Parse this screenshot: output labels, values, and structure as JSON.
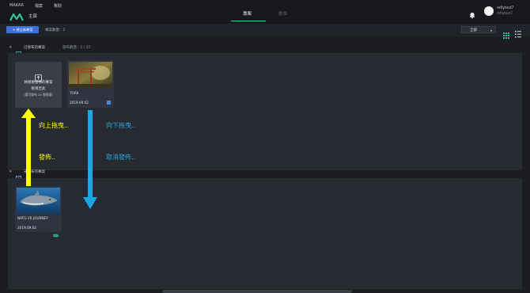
{
  "top_menu": {
    "brand": "MAKAR",
    "items": [
      "檔案",
      "幫助"
    ]
  },
  "home_label": "主頁",
  "tabs": {
    "active": "專案",
    "inactive": "教學"
  },
  "user": {
    "name": "mfiytest7",
    "id": "mfiytest7"
  },
  "toolbar": {
    "new_project": "+ 建立新專案",
    "project_count": "專案數量：2",
    "filter_value": "全部"
  },
  "published_section": {
    "label": "已發布的專案",
    "count": "發布數量：1 / 25"
  },
  "unpublished_section": {
    "label": "未發布的專案"
  },
  "drop_zone": {
    "line1": "將想要發佈的專案",
    "line2": "拖曳至此",
    "line3": "(還可發布 24 個專案)"
  },
  "published_projects": [
    {
      "name": "TORII",
      "date": "2019.09.02"
    }
  ],
  "unpublished_projects": [
    {
      "name": "NATG VR JOURNEY",
      "date": "2019.09.02"
    }
  ],
  "annotations": {
    "drag_up": "向上拖曳..",
    "publish": "發佈..",
    "drag_down": "向下拖曳..",
    "unpublish": "取消發佈.."
  },
  "colors": {
    "accent": "#2fc1a6",
    "primary_button": "#3f6fd8",
    "arrow_up": "#ffff00",
    "arrow_down": "#19a8e6",
    "annot_down_text": "#2aa8e8"
  }
}
